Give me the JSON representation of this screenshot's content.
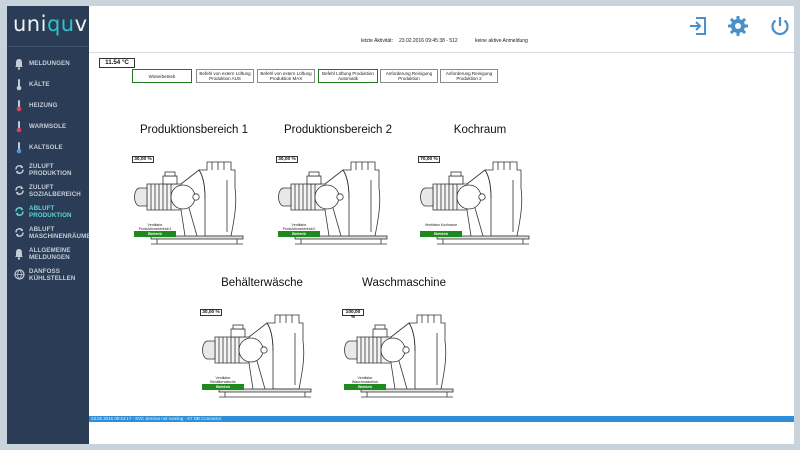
{
  "app": {
    "logo_prefix": "uni",
    "logo_accent": "qu",
    "logo_suffix": "vis",
    "accent_color": "#2ec4c8",
    "sidebar_color": "#2b3d56"
  },
  "sidebar": {
    "items": [
      {
        "label": "MELDUNGEN",
        "icon": "bell-icon"
      },
      {
        "label": "KÄLTE",
        "icon": "thermometer-icon"
      },
      {
        "label": "HEIZUNG",
        "icon": "thermometer-icon"
      },
      {
        "label": "WARMSOLE",
        "icon": "thermometer-icon"
      },
      {
        "label": "KALTSOLE",
        "icon": "thermometer-icon"
      },
      {
        "label": "ZULUFT PRODUKTION",
        "icon": "refresh-icon"
      },
      {
        "label": "ZULUFT SOZIALBEREICH",
        "icon": "refresh-icon"
      },
      {
        "label": "ABLUFT PRODUKTION",
        "icon": "refresh-icon",
        "active": true
      },
      {
        "label": "ABLUFT MASCHINENRÄUME",
        "icon": "refresh-icon"
      },
      {
        "label": "ALLGEMEINE MELDUNGEN",
        "icon": "bell-icon"
      },
      {
        "label": "DANFOSS KÜHLSTELLEN",
        "icon": "globe-icon"
      }
    ]
  },
  "header": {
    "activity_label": "letzte Aktivität:",
    "activity_time": "23.02.2016 09:45:38 - 512",
    "login_status": "keine aktive Anmeldung",
    "icons": [
      "logout-icon",
      "settings-gear-icon",
      "power-icon"
    ]
  },
  "main": {
    "temperature": "11.54 °C",
    "mode_buttons": [
      {
        "label": "Winterbetrieb",
        "active": true
      },
      {
        "label": "Befehl von extern Lüftung Produktion AUS",
        "active": false
      },
      {
        "label": "Befehl von extern Lüftung Produktion MAX",
        "active": false
      },
      {
        "label": "Befehl Lüftung Produktion Automatik",
        "active": true
      },
      {
        "label": "Anforderung Reinigung Produktion",
        "active": false
      },
      {
        "label": "Anforderung Reinigung Produktion 2",
        "active": false
      }
    ],
    "units": [
      {
        "title": "Produktionsbereich 1",
        "value": "30,00 %",
        "caption": "Ventilator Produktionsbereich1",
        "state": "Betrieb"
      },
      {
        "title": "Produktionsbereich 2",
        "value": "30,00 %",
        "caption": "Ventilator Produktionsbereich2",
        "state": "Betrieb"
      },
      {
        "title": "Kochraum",
        "value": "70,00 %",
        "caption": "Ventilator Kochraum",
        "state": "Betrieb"
      },
      {
        "title": "Behälterwäsche",
        "value": "30,00 %",
        "caption": "Ventilator Behälterwäsche",
        "state": "Betrieb"
      },
      {
        "title": "Waschmaschine",
        "value": "100,00 %",
        "caption": "Ventilator Waschmaschine",
        "state": "Betrieb"
      }
    ]
  },
  "footer": {
    "status": "23.02.2016 09:44:17 - SVC Service not running - S7 DB Connector",
    "color": "#2e8fd8"
  }
}
